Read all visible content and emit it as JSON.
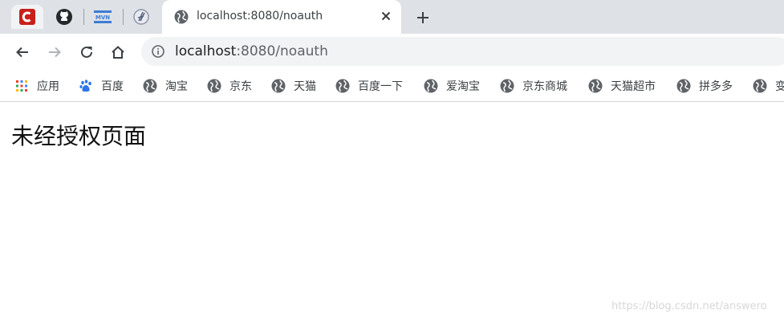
{
  "tab": {
    "title": "localhost:8080/noauth"
  },
  "pinned_tabs": [
    {
      "name": "csdn-app-icon"
    },
    {
      "name": "github-icon"
    },
    {
      "name": "mvn-icon"
    },
    {
      "name": "shrimp-icon"
    }
  ],
  "address_bar": {
    "host": "localhost",
    "rest": ":8080/noauth"
  },
  "bookmarks": [
    {
      "label": "应用",
      "icon": "apps-grid-icon"
    },
    {
      "label": "百度",
      "icon": "baidu-paw-icon"
    },
    {
      "label": "淘宝",
      "icon": "globe-icon"
    },
    {
      "label": "京东",
      "icon": "globe-icon"
    },
    {
      "label": "天猫",
      "icon": "globe-icon"
    },
    {
      "label": "百度一下",
      "icon": "globe-icon"
    },
    {
      "label": "爱淘宝",
      "icon": "globe-icon"
    },
    {
      "label": "京东商城",
      "icon": "globe-icon"
    },
    {
      "label": "天猫超市",
      "icon": "globe-icon"
    },
    {
      "label": "拼多多",
      "icon": "globe-icon"
    },
    {
      "label": "变",
      "icon": "globe-icon"
    }
  ],
  "page": {
    "heading": "未经授权页面",
    "watermark": "https://blog.csdn.net/answero"
  },
  "colors": {
    "tabstrip_bg": "#dee1e6",
    "omnibox_bg": "#f1f3f4",
    "csdn_red": "#c9201a",
    "mvn_blue": "#3d7bd6",
    "baidu_blue": "#2f76e8"
  }
}
